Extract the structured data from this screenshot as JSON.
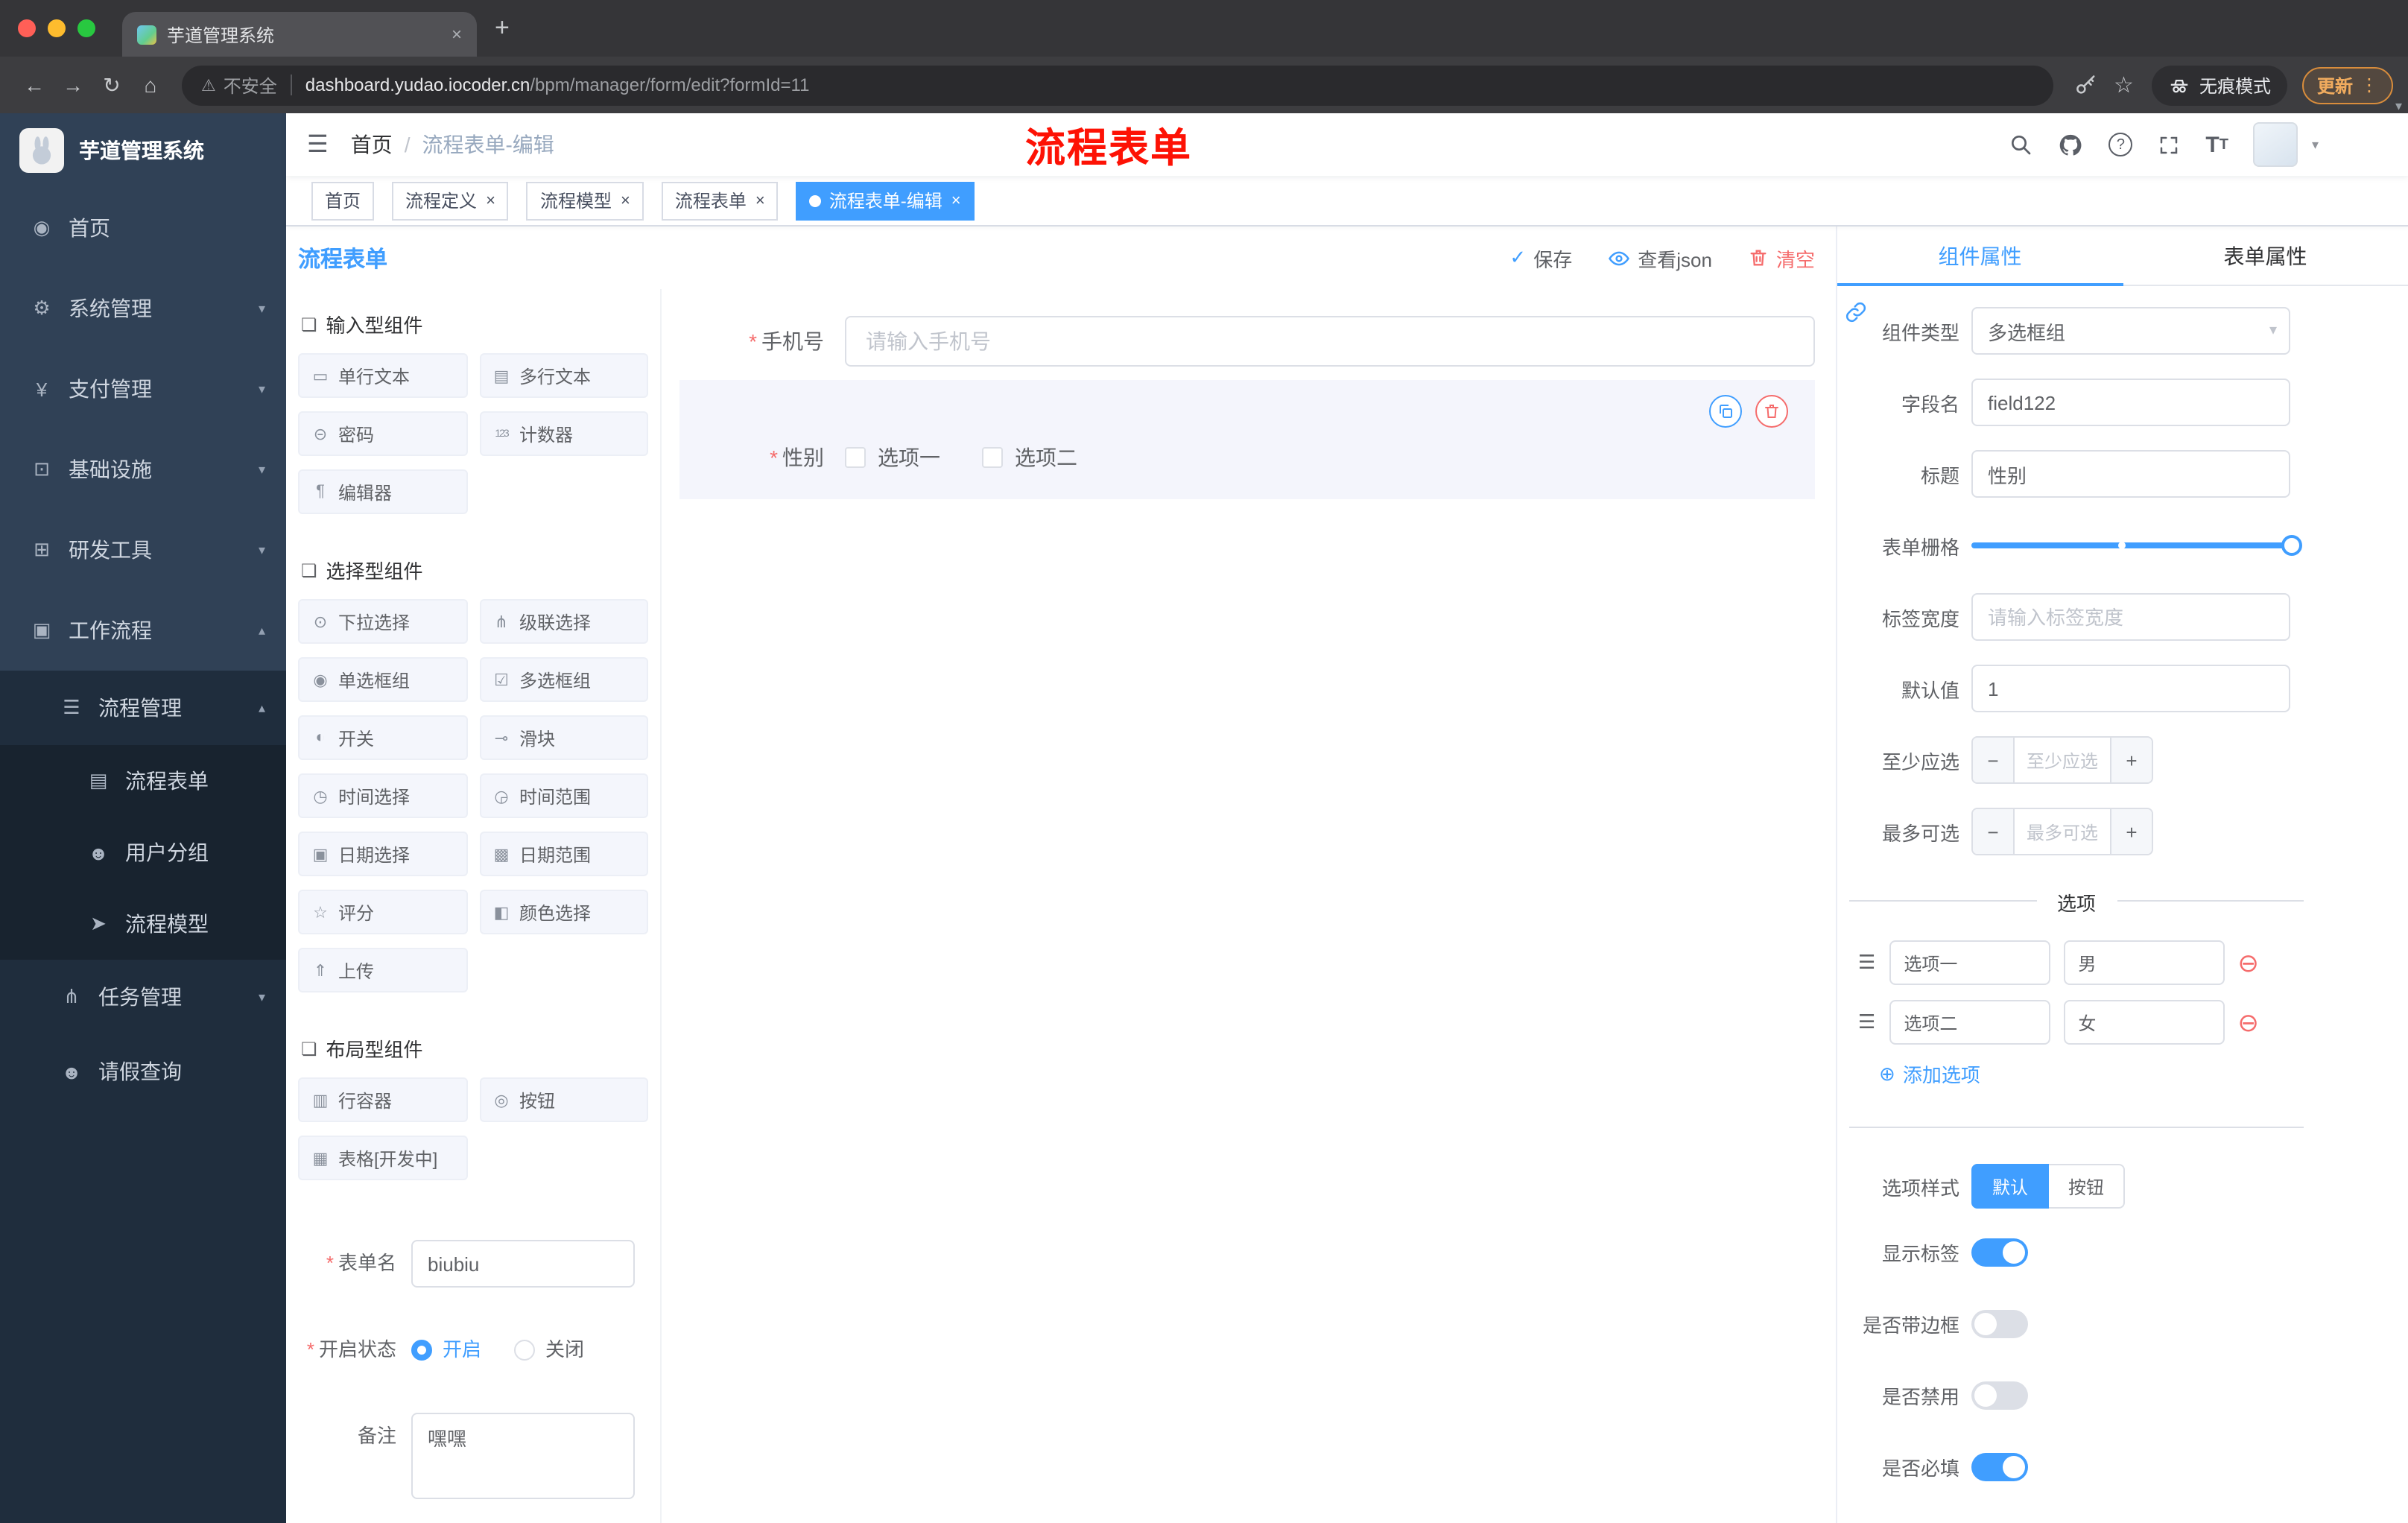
{
  "colors": {
    "accent": "#409eff",
    "danger": "#f56c6c",
    "title_red": "#fd1205",
    "update_orange": "#f0ab5e"
  },
  "misc": {
    "required_mark": "*"
  },
  "browser": {
    "tab_title": "芋道管理系统",
    "security_label": "不安全",
    "url_host": "dashboard.yudao.iocoder.cn",
    "url_path": "/bpm/manager/form/edit?formId=11",
    "incognito_label": "无痕模式",
    "update_label": "更新"
  },
  "sidebar": {
    "logo_title": "芋道管理系统",
    "menu": [
      {
        "label": "首页"
      },
      {
        "label": "系统管理"
      },
      {
        "label": "支付管理"
      },
      {
        "label": "基础设施"
      },
      {
        "label": "研发工具"
      },
      {
        "label": "工作流程"
      }
    ],
    "process_mgmt": {
      "label": "流程管理"
    },
    "process_children": [
      {
        "label": "流程表单"
      },
      {
        "label": "用户分组"
      },
      {
        "label": "流程模型"
      }
    ],
    "task_mgmt": {
      "label": "任务管理"
    },
    "leave_query": {
      "label": "请假查询"
    }
  },
  "header": {
    "breadcrumb_home": "首页",
    "breadcrumb_separator": "/",
    "breadcrumb_current": "流程表单-编辑",
    "overlay_title": "流程表单"
  },
  "tags": [
    {
      "label": "首页"
    },
    {
      "label": "流程定义"
    },
    {
      "label": "流程模型"
    },
    {
      "label": "流程表单"
    },
    {
      "label": "流程表单-编辑"
    }
  ],
  "designer": {
    "panel_title": "流程表单",
    "save_label": "保存",
    "view_json_label": "查看json",
    "clear_label": "清空"
  },
  "palette": {
    "sections": [
      {
        "title": "输入型组件",
        "items": [
          {
            "label": "单行文本",
            "icon": "input-icon"
          },
          {
            "label": "多行文本",
            "icon": "textarea-icon"
          },
          {
            "label": "密码",
            "icon": "password-icon"
          },
          {
            "label": "计数器",
            "icon": "counter-icon"
          },
          {
            "label": "编辑器",
            "icon": "editor-icon"
          }
        ]
      },
      {
        "title": "选择型组件",
        "items": [
          {
            "label": "下拉选择",
            "icon": "select-icon"
          },
          {
            "label": "级联选择",
            "icon": "cascader-icon"
          },
          {
            "label": "单选框组",
            "icon": "radio-group-icon"
          },
          {
            "label": "多选框组",
            "icon": "checkbox-group-icon"
          },
          {
            "label": "开关",
            "icon": "switch-icon"
          },
          {
            "label": "滑块",
            "icon": "slider-icon"
          },
          {
            "label": "时间选择",
            "icon": "time-icon"
          },
          {
            "label": "时间范围",
            "icon": "time-range-icon"
          },
          {
            "label": "日期选择",
            "icon": "date-icon"
          },
          {
            "label": "日期范围",
            "icon": "date-range-icon"
          },
          {
            "label": "评分",
            "icon": "rate-icon"
          },
          {
            "label": "颜色选择",
            "icon": "color-icon"
          },
          {
            "label": "上传",
            "icon": "upload-icon"
          }
        ]
      },
      {
        "title": "布局型组件",
        "items": [
          {
            "label": "行容器",
            "icon": "row-icon"
          },
          {
            "label": "按钮",
            "icon": "button-icon"
          },
          {
            "label": "表格[开发中]",
            "icon": "table-icon"
          }
        ]
      }
    ]
  },
  "form_config": {
    "name_label": "表单名",
    "name_value": "biubiu",
    "status_label": "开启状态",
    "status_on": "开启",
    "status_off": "关闭",
    "remark_label": "备注",
    "remark_value": "嘿嘿"
  },
  "canvas": {
    "phone_label": "手机号",
    "phone_placeholder": "请输入手机号",
    "gender_label": "性别",
    "gender_options": [
      "选项一",
      "选项二"
    ]
  },
  "props": {
    "tab_component": "组件属性",
    "tab_form": "表单属性",
    "component_type_label": "组件类型",
    "component_type_value": "多选框组",
    "field_name_label": "字段名",
    "field_name_value": "field122",
    "title_label": "标题",
    "title_value": "性别",
    "grid_label": "表单栅格",
    "label_width_label": "标签宽度",
    "label_width_placeholder": "请输入标签宽度",
    "default_label": "默认值",
    "default_value": "1",
    "min_label": "至少应选",
    "min_placeholder": "至少应选",
    "max_label": "最多可选",
    "max_placeholder": "最多可选",
    "minus": "−",
    "plus": "+",
    "options_title": "选项",
    "options": [
      {
        "name": "选项一",
        "value": "男"
      },
      {
        "name": "选项二",
        "value": "女"
      }
    ],
    "add_option_label": "添加选项",
    "style_label": "选项样式",
    "style_default": "默认",
    "style_button": "按钮",
    "switch_show_label": "显示标签",
    "switch_border_label": "是否带边框",
    "switch_disabled_label": "是否禁用",
    "switch_required_label": "是否必填"
  },
  "icon_glyphs": {
    "back-icon": "←",
    "forward-icon": "→",
    "reload-icon": "↻",
    "home-icon": "⌂",
    "warning-icon": "⚠",
    "star-icon": "☆",
    "more-vert-icon": "⋮",
    "caret-down-icon": "▾",
    "close-icon": "×",
    "new-tab-icon": "+",
    "hamburger-icon": "☰",
    "question-icon": "?",
    "dashboard-icon": "◉",
    "gear-icon": "⚙",
    "yen-icon": "¥",
    "infra-icon": "⊡",
    "devtools-icon": "⊞",
    "workflow-icon": "▣",
    "chevron-down": "▾",
    "chevron-up": "▴",
    "process-mgmt-icon": "☰",
    "process-form-icon": "▤",
    "user-group-icon": "☻",
    "process-model-icon": "➤",
    "task-mgmt-icon": "⋔",
    "leave-query-icon": "☻",
    "section-icon": "❏",
    "input-icon": "▭",
    "textarea-icon": "▤",
    "password-icon": "⊝",
    "counter-icon": "123",
    "editor-icon": "¶",
    "select-icon": "⊙",
    "cascader-icon": "⋔",
    "radio-group-icon": "◉",
    "checkbox-group-icon": "☑",
    "switch-icon": "◐",
    "slider-icon": "⊸",
    "time-icon": "◷",
    "time-range-icon": "◶",
    "date-icon": "▣",
    "date-range-icon": "▩",
    "rate-icon": "☆",
    "color-icon": "◧",
    "upload-icon": "⇑",
    "row-icon": "▥",
    "button-icon": "◎",
    "table-icon": "▦",
    "check-icon": "✓",
    "drag-icon": "☰",
    "remove-icon": "⊖",
    "add-icon": "⊕",
    "font-size-icon": "T"
  }
}
